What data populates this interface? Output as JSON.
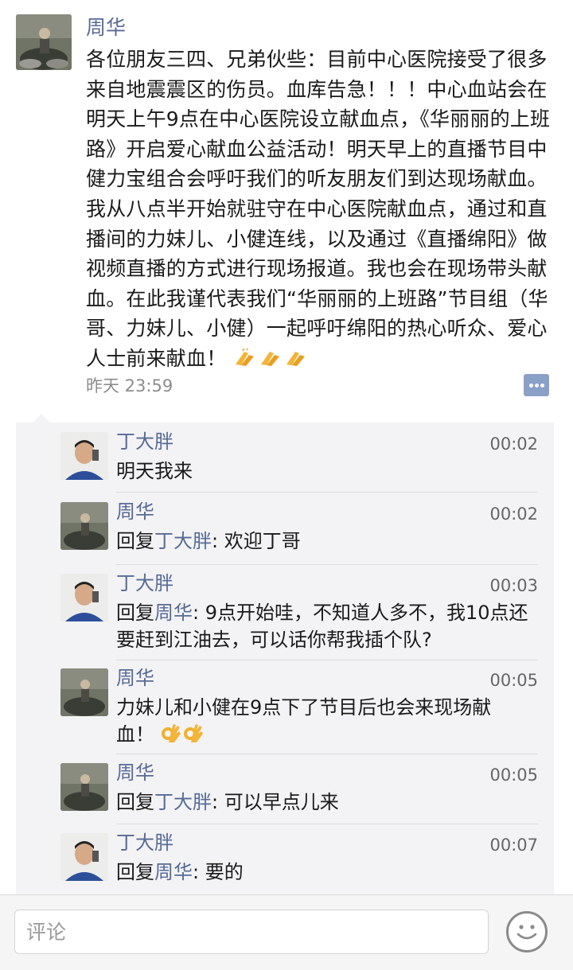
{
  "post": {
    "author": "周华",
    "body": "各位朋友三四、兄弟伙些：目前中心医院接受了很多来自地震震区的伤员。血库告急！！！中心血站会在明天上午9点在中心医院设立献血点，《华丽丽的上班路》开启爱心献血公益活动！明天早上的直播节目中健力宝组合会呼吁我们的听友朋友们到达现场献血。我从八点半开始就驻守在中心医院献血点，通过和直播间的力妹儿、小健连线，以及通过《直播绵阳》做视频直播的方式进行现场报道。我也会在现场带头献血。在此我谨代表我们“华丽丽的上班路”节目组（华哥、力妹儿、小健）一起呼吁绵阳的热心听众、爱心人士前来献血！",
    "emoji": "clapping-hands",
    "time": "昨天 23:59"
  },
  "comments": [
    {
      "author": "丁大胖",
      "avatar": "ding",
      "time": "00:02",
      "reply_prefix": "",
      "reply_to": "",
      "text": "明天我来",
      "emoji_count": 0
    },
    {
      "author": "周华",
      "avatar": "zhou",
      "time": "00:02",
      "reply_prefix": "回复",
      "reply_to": "丁大胖",
      "text": ": 欢迎丁哥",
      "emoji_count": 0
    },
    {
      "author": "丁大胖",
      "avatar": "ding",
      "time": "00:03",
      "reply_prefix": "回复",
      "reply_to": "周华",
      "text": ": 9点开始哇，不知道人多不，我10点还要赶到江油去，可以话你帮我插个队?",
      "emoji_count": 0
    },
    {
      "author": "周华",
      "avatar": "zhou",
      "time": "00:05",
      "reply_prefix": "",
      "reply_to": "",
      "text": "力妹儿和小健在9点下了节目后也会来现场献血！",
      "emoji_count": 2
    },
    {
      "author": "周华",
      "avatar": "zhou",
      "time": "00:05",
      "reply_prefix": "回复",
      "reply_to": "丁大胖",
      "text": ": 可以早点儿来",
      "emoji_count": 0
    },
    {
      "author": "丁大胖",
      "avatar": "ding",
      "time": "00:07",
      "reply_prefix": "回复",
      "reply_to": "周华",
      "text": ": 要的",
      "emoji_count": 0
    }
  ],
  "input": {
    "placeholder": "评论"
  },
  "icons": {
    "comment_button": "comment-dots-icon",
    "emoji_button": "smiley-face-icon"
  },
  "colors": {
    "name": "#576b95",
    "comment_bg": "#f3f3f5",
    "comment_button": "#8aa0c6"
  }
}
